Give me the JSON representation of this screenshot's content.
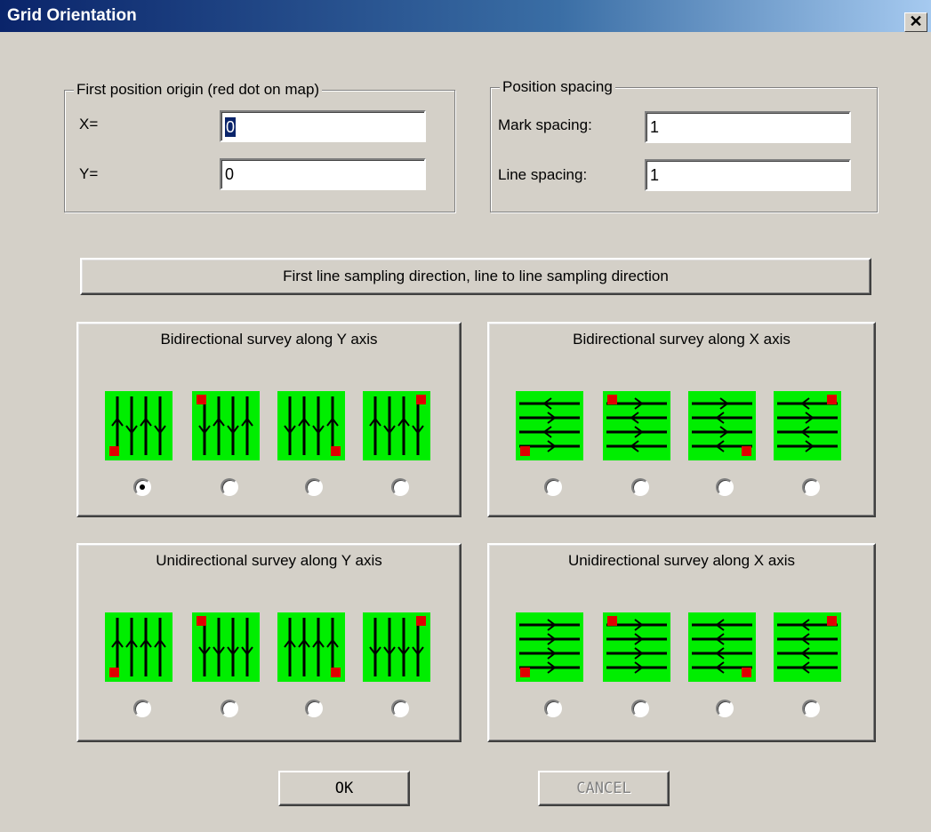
{
  "window": {
    "title": "Grid Orientation",
    "close_label": "✕"
  },
  "origin": {
    "title": "First position origin  (red dot on map)",
    "x_label": "X=",
    "x_value": "0",
    "y_label": "Y=",
    "y_value": "0"
  },
  "spacing": {
    "title": "Position spacing",
    "mark_label": "Mark spacing:",
    "mark_value": "1",
    "line_label": "Line spacing:",
    "line_value": "1"
  },
  "heading": "First line sampling direction, line to line sampling direction",
  "surveys": [
    {
      "title": "Bidirectional survey along Y axis",
      "axis": "y",
      "mode": "bi",
      "selected_option": 0
    },
    {
      "title": "Bidirectional survey along X axis",
      "axis": "x",
      "mode": "bi",
      "selected_option": null
    },
    {
      "title": "Unidirectional survey along Y axis",
      "axis": "y",
      "mode": "uni",
      "selected_option": null
    },
    {
      "title": "Unidirectional survey along X axis",
      "axis": "x",
      "mode": "uni",
      "selected_option": null
    }
  ],
  "buttons": {
    "ok": "OK",
    "cancel": "CANCEL"
  },
  "colors": {
    "tile_bg": "#00ee00",
    "origin_dot": "#e00000",
    "title_start": "#0a246a"
  }
}
